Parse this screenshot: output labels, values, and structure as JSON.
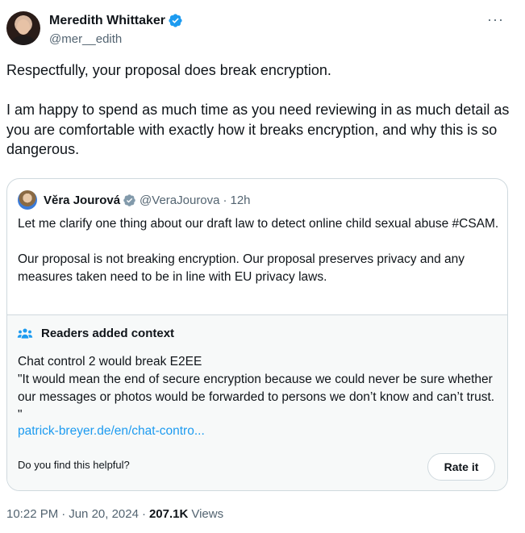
{
  "author": {
    "name": "Meredith Whittaker",
    "handle": "@mer__edith"
  },
  "tweet": {
    "text": "Respectfully, your proposal does break encryption.\n\nI am happy to spend as much time as you need reviewing in as much detail as you are comfortable with exactly how it breaks encryption, and why this is so dangerous."
  },
  "quote": {
    "name": "Věra Jourová",
    "handle": "@VeraJourova",
    "separator": "·",
    "time": "12h",
    "text": "Let me clarify one thing about our draft law to detect online child sexual abuse #CSAM.\n\nOur proposal is not breaking encryption. Our proposal preserves privacy and any measures taken need to be in line with EU privacy laws."
  },
  "context": {
    "heading": "Readers added context",
    "body": "Chat control 2 would break E2EE\n\"It would mean the end of secure encryption because we could never be sure whether our messages or photos would be forwarded to persons we don’t know and can’t trust. \"",
    "link": "patrick-breyer.de/en/chat-contro...",
    "prompt": "Do you find this helpful?",
    "rate_label": "Rate it"
  },
  "meta": {
    "time": "10:22 PM",
    "separator": "·",
    "date": "Jun 20, 2024",
    "views_count": "207.1K",
    "views_label": "Views"
  },
  "icons": {
    "verified": "verified-badge-icon",
    "government": "government-badge-icon",
    "more": "more-icon",
    "context": "people-icon"
  },
  "colors": {
    "accent": "#1d9bf0",
    "gov_badge": "#829aab"
  }
}
